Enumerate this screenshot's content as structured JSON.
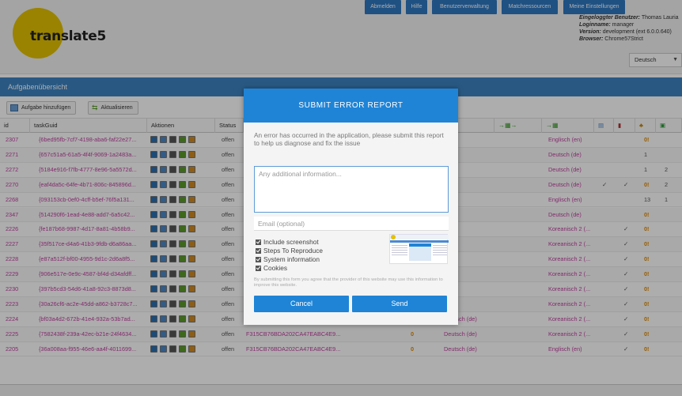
{
  "header": {
    "logo_text": "translate5",
    "user_label": "Eingeloggter Benutzer:",
    "user_value": "Thomas Lauria",
    "login_label": "Loginname:",
    "login_value": "manager",
    "version_label": "Version:",
    "version_value": "development (ext 6.0.0.640)",
    "browser_label": "Browser:",
    "browser_value": "Chrome57Strict",
    "buttons": [
      "Abmelden",
      "Hilfe",
      "Benutzerverwaltung",
      "Matchressourcen",
      "Meine Einstellungen"
    ],
    "language": "Deutsch"
  },
  "panel": {
    "title": "Aufgabenübersicht",
    "add_task": "Aufgabe hinzufügen",
    "refresh": "Aktualisieren"
  },
  "grid": {
    "columns": [
      "id",
      "taskGuid",
      "Aktionen",
      "Status"
    ],
    "rows": [
      {
        "id": "2307",
        "guid": "{6bed95fb-7cf7-4198-aba6-faf22e27...",
        "status": "offen",
        "source": "...ch (de)",
        "target": "Englisch (en)",
        "c1": "",
        "c2": "",
        "n1": "0!",
        "n2": ""
      },
      {
        "id": "2271",
        "guid": "{657c51a5-61a5-4f4f-9069-1a2483a...",
        "status": "offen",
        "source": "...ch (en)",
        "target": "Deutsch (de)",
        "c1": "",
        "c2": "",
        "n1": "1",
        "n2": ""
      },
      {
        "id": "2272",
        "guid": "{5184e916-f7fb-4777-8e96-5a5572d...",
        "status": "offen",
        "source": "...ch (en)",
        "target": "Deutsch (de)",
        "c1": "",
        "c2": "",
        "n1": "1",
        "n2": "2"
      },
      {
        "id": "2270",
        "guid": "{eaf4da5c-64fe-4b71-806c-845896d...",
        "status": "offen",
        "source": "...ch (en)",
        "target": "Deutsch (de)",
        "c1": "✓",
        "c2": "✓",
        "n1": "0!",
        "n2": "2"
      },
      {
        "id": "2268",
        "guid": "{093153cb-0ef0-4cff-b5ef-76f5a131...",
        "status": "offen",
        "source": "...ch (de)",
        "target": "Englisch (en)",
        "c1": "",
        "c2": "",
        "n1": "13",
        "n2": "1"
      },
      {
        "id": "2347",
        "guid": "{514290f6-1ead-4e88-add7-6a5c42...",
        "status": "offen",
        "source": "...ch (en)",
        "target": "Deutsch (de)",
        "c1": "",
        "c2": "",
        "n1": "0!",
        "n2": ""
      },
      {
        "id": "2226",
        "guid": "{fe187b68-9987-4d17-8a81-4b58b9...",
        "status": "offen",
        "source": "...ch (de)",
        "target": "Koreanisch 2 (...",
        "c1": "",
        "c2": "✓",
        "n1": "0!",
        "n2": ""
      },
      {
        "id": "2227",
        "guid": "{35f517ce-d4a6-41b3-9fdb-d6a86aa...",
        "status": "offen",
        "source": "...ch (de)",
        "target": "Koreanisch 2 (...",
        "c1": "",
        "c2": "✓",
        "n1": "0!",
        "n2": ""
      },
      {
        "id": "2228",
        "guid": "{e87a512f-bf00-4955-9d1c-2d6a8f5...",
        "status": "offen",
        "source": "...ch (de)",
        "target": "Koreanisch 2 (...",
        "c1": "",
        "c2": "✓",
        "n1": "0!",
        "n2": ""
      },
      {
        "id": "2229",
        "guid": "{906e517e-0e9c-4587-bf4d-d34afdff...",
        "status": "offen",
        "source": "...ch (de)",
        "target": "Koreanisch 2 (...",
        "c1": "",
        "c2": "✓",
        "n1": "0!",
        "n2": ""
      },
      {
        "id": "2230",
        "guid": "{397b5cd3-54d6-41a8-92c3-8873d8...",
        "status": "offen",
        "source": "...ch (de)",
        "target": "Koreanisch 2 (...",
        "c1": "",
        "c2": "✓",
        "n1": "0!",
        "n2": ""
      },
      {
        "id": "2223",
        "guid": "{30a26cf6-ac2e-45dd-a862-b3728c7...",
        "status": "offen",
        "source": "...ch (de)",
        "target": "Koreanisch 2 (...",
        "c1": "",
        "c2": "✓",
        "n1": "0!",
        "n2": ""
      },
      {
        "id": "2224",
        "guid": "{bf03a4d2-672b-41e4-932a-53b7ad...",
        "status": "offen",
        "source": "F315CB76BDA202CA47EABC4E9...",
        "src_num": "0",
        "target2": "Deutsch (de)",
        "target": "Koreanisch 2 (...",
        "c1": "",
        "c2": "✓",
        "n1": "0!",
        "n2": ""
      },
      {
        "id": "2225",
        "guid": "{7582438f-239a-42ec-b21e-24f4634...",
        "status": "offen",
        "source": "F315CB76BDA202CA47EABC4E9...",
        "src_num": "0",
        "target2": "Deutsch (de)",
        "target": "Koreanisch 2 (...",
        "c1": "",
        "c2": "✓",
        "n1": "0!",
        "n2": ""
      },
      {
        "id": "2205",
        "guid": "{36a008aa-f955-46e6-aa4f-4011699...",
        "status": "offen",
        "source": "F315CB76BDA202CA47EABC4E9...",
        "src_num": "0",
        "target2": "Deutsch (de)",
        "target": "Englisch (en)",
        "c1": "",
        "c2": "✓",
        "n1": "0!",
        "n2": ""
      }
    ]
  },
  "modal": {
    "title": "SUBMIT ERROR REPORT",
    "message": "An error has occurred in the application, please submit this report to help us diagnose and fix the issue",
    "info_placeholder": "Any additional information...",
    "email_placeholder": "Email (optional)",
    "options": [
      "Include screenshot",
      "Steps To Reproduce",
      "System information",
      "Cookies"
    ],
    "disclaimer": "By submitting this form you agree that the provider of this website may use this information to improve this website.",
    "cancel": "Cancel",
    "send": "Send"
  },
  "colors": {
    "primary": "#1f84d6",
    "panel_blue": "#3d83c2",
    "logo_yellow": "#e3c200",
    "link_pink": "#c040a0",
    "warning_orange": "#e08a00"
  }
}
